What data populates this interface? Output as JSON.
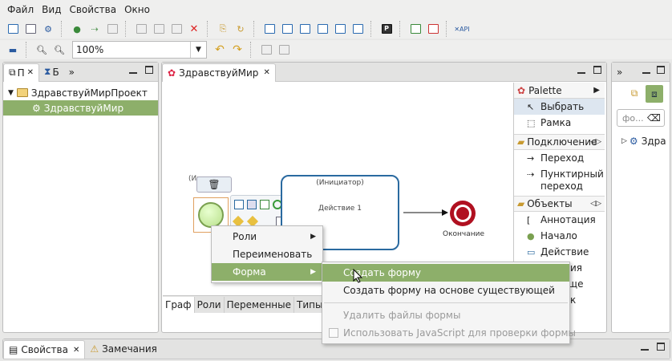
{
  "menubar": {
    "items": [
      "Файл",
      "Вид",
      "Свойства",
      "Окно"
    ]
  },
  "toolbar2": {
    "zoom": "100%"
  },
  "left_panel": {
    "tabs": [
      "П",
      "Б"
    ],
    "overflow": "»",
    "tree": [
      {
        "label": "ЗдравствуйМирПроект",
        "icon": "project-icon"
      },
      {
        "label": "ЗдравствуйМир",
        "icon": "process-icon",
        "selected": true
      }
    ]
  },
  "editor": {
    "tab_label": "ЗдравствуйМир",
    "diagram": {
      "start_label": "(Иниц",
      "action_role": "(Инициатор)",
      "action_name": "Действие 1",
      "end_label": "Окончание"
    },
    "bottom_tabs": [
      "Граф",
      "Роли",
      "Переменные",
      "Типы да"
    ]
  },
  "palette": {
    "title": "Palette",
    "tools": [
      {
        "label": "Выбрать",
        "icon": "cursor-icon",
        "selected": true
      },
      {
        "label": "Рамка",
        "icon": "marquee-icon"
      }
    ],
    "drawers": [
      {
        "label": "Подключение",
        "items": [
          {
            "label": "Переход",
            "icon": "arrow-icon"
          },
          {
            "label": "Пунктирный переход",
            "icon": "dotted-arrow-icon"
          }
        ]
      },
      {
        "label": "Объекты",
        "items": [
          {
            "label": "Аннотация",
            "icon": "annotation-icon"
          },
          {
            "label": "Начало",
            "icon": "start-icon"
          },
          {
            "label": "Действие",
            "icon": "action-icon"
          }
        ]
      }
    ],
    "hidden_fragments": [
      "ия",
      "ище",
      "к"
    ]
  },
  "right_panel": {
    "overflow": "»",
    "search_placeholder": "фо...",
    "tree": [
      {
        "label": "Здра",
        "icon": "process-icon"
      }
    ]
  },
  "context_menu": {
    "items": [
      {
        "label": "Роли",
        "submenu": true
      },
      {
        "label": "Переименовать"
      },
      {
        "label": "Форма",
        "submenu": true,
        "highlighted": true
      }
    ]
  },
  "submenu": {
    "items": [
      {
        "label": "Создать форму",
        "highlighted": true
      },
      {
        "label": "Создать форму на основе существующей"
      },
      {
        "label": "Удалить файлы формы",
        "disabled": true
      },
      {
        "label": "Использовать JavaScript для проверки формы",
        "disabled": true,
        "checkbox": true
      }
    ]
  },
  "bottom_panel": {
    "tabs": [
      "Свойства",
      "Замечания"
    ]
  },
  "colors": {
    "accent": "#8daf6a",
    "node_border": "#2a6aa0",
    "end_event": "#b01020",
    "start_fill": "#b8e08a"
  }
}
